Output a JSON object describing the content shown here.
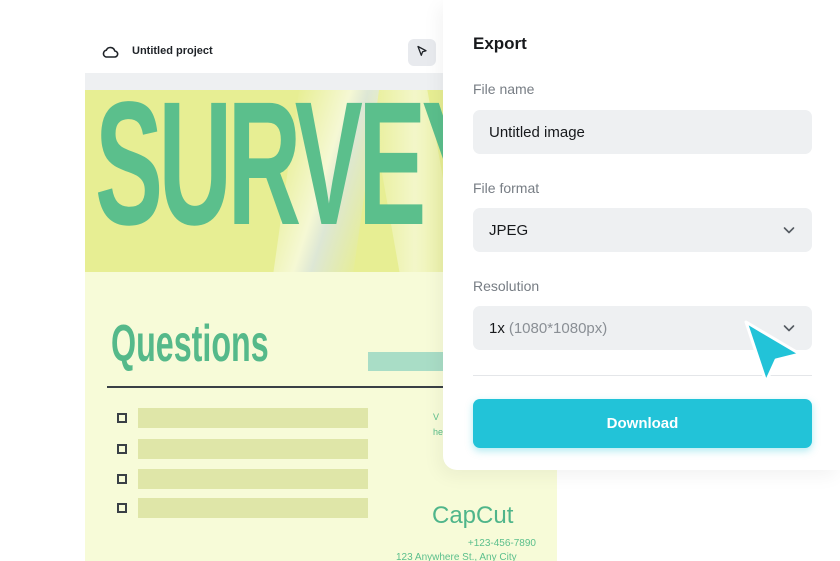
{
  "editor": {
    "project_title": "Untitled project",
    "canvas": {
      "hero_word": "SURVEY",
      "section_title": "Questions",
      "side_text_line1": "V",
      "side_text_line2": "he",
      "brand": "CapCut",
      "phone": "+123-456-7890",
      "address": "123 Anywhere St., Any City"
    }
  },
  "export_panel": {
    "title": "Export",
    "file_name_label": "File name",
    "file_name_value": "Untitled image",
    "file_format_label": "File format",
    "file_format_value": "JPEG",
    "resolution_label": "Resolution",
    "resolution_value": "1x",
    "resolution_detail": "(1080*1080px)",
    "download_label": "Download"
  },
  "colors": {
    "accent": "#22c3d8",
    "canvas_green": "#5bbf8c",
    "hero_yellow": "#e7ee93"
  },
  "icons": [
    "cloud-icon",
    "cursor-icon",
    "chevron-down-icon",
    "pointer-arrow-icon"
  ]
}
